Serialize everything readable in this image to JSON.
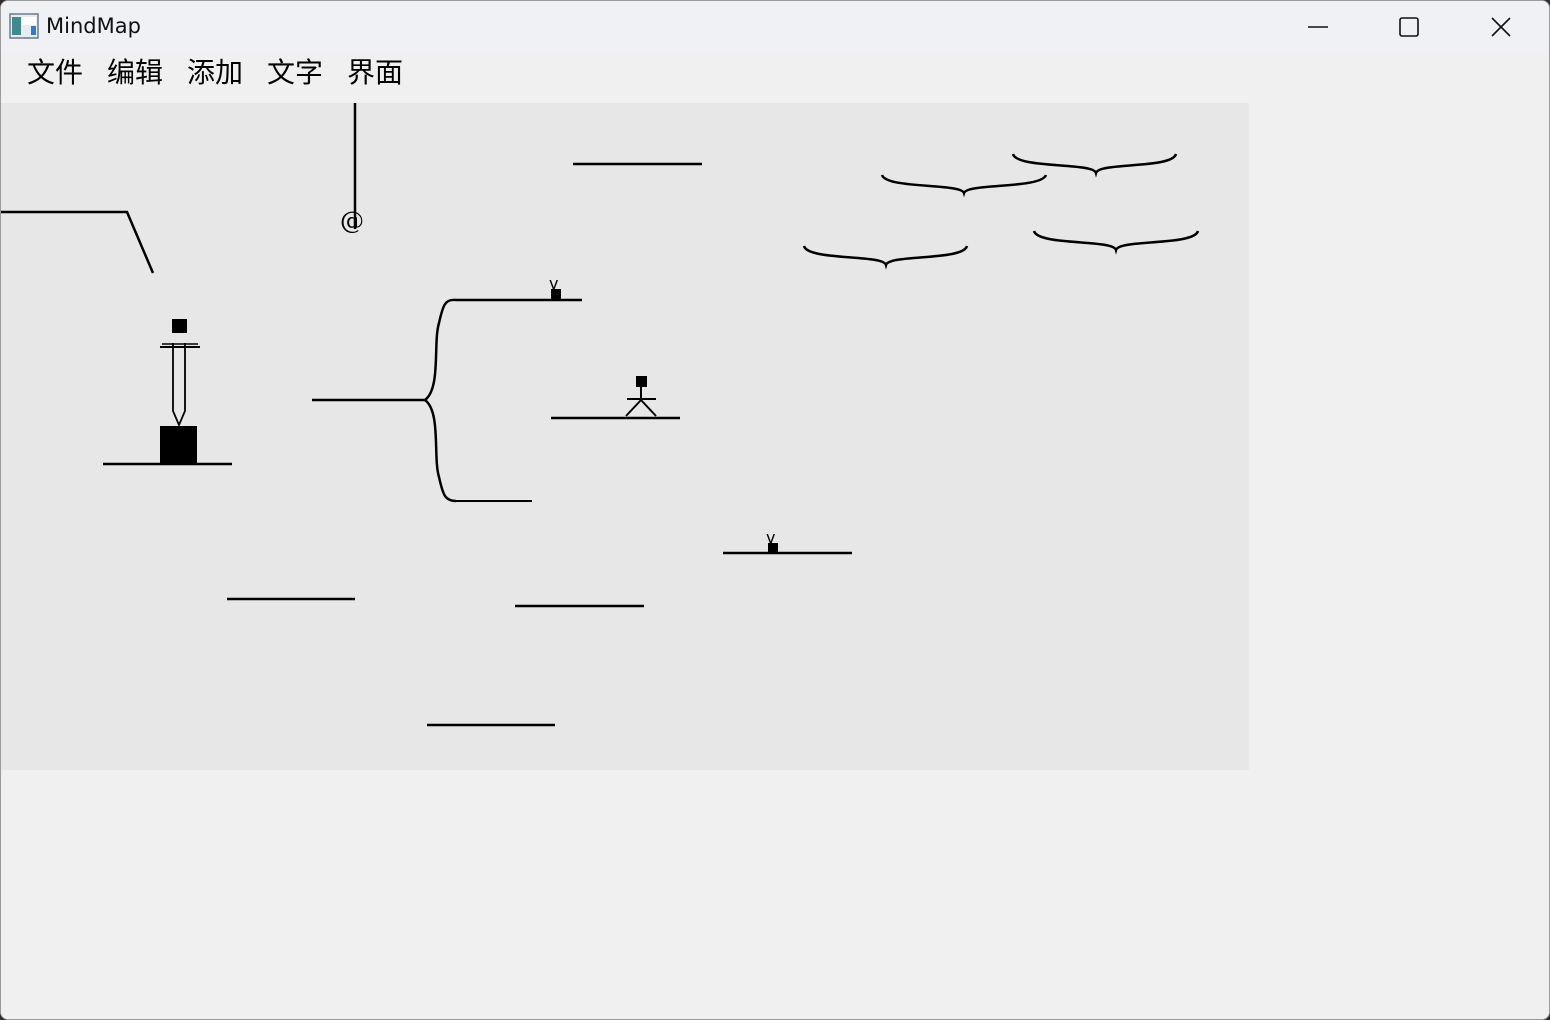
{
  "window": {
    "title": "MindMap",
    "controls": [
      "minimize-icon",
      "maximize-icon",
      "close-icon"
    ]
  },
  "menubar": {
    "items": [
      {
        "label": "文件"
      },
      {
        "label": "编辑"
      },
      {
        "label": "添加"
      },
      {
        "label": "文字"
      },
      {
        "label": "界面"
      }
    ]
  },
  "canvas": {
    "at_symbol": "@",
    "v_marks": [
      "v",
      "v"
    ],
    "icons": [
      "lighthouse-icon",
      "stick-figure-icon",
      "curly-brace-icon"
    ]
  },
  "colors": {
    "titlebar": "#eff1f5",
    "window": "#f0f0f0",
    "canvas": "#e7e7e7",
    "stroke": "#000000"
  }
}
